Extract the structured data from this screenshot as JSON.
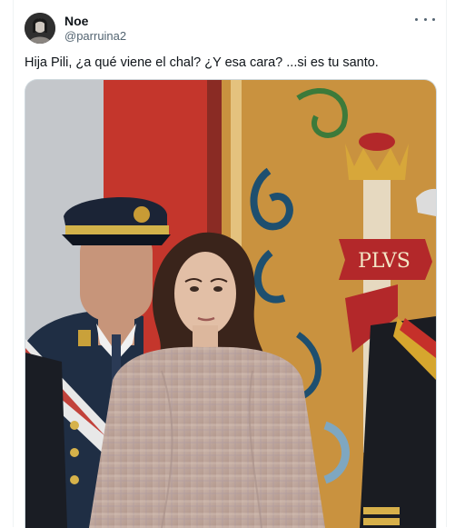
{
  "author": {
    "display_name": "Noe",
    "handle": "@parruina2",
    "avatar_icon": "user-avatar"
  },
  "more_icon": "more-options-icon",
  "post": {
    "text": "Hija Pili, ¿a qué viene el chal? ¿Y esa cara? ...si es tu santo."
  },
  "media": {
    "banner_text": "PLVS"
  }
}
